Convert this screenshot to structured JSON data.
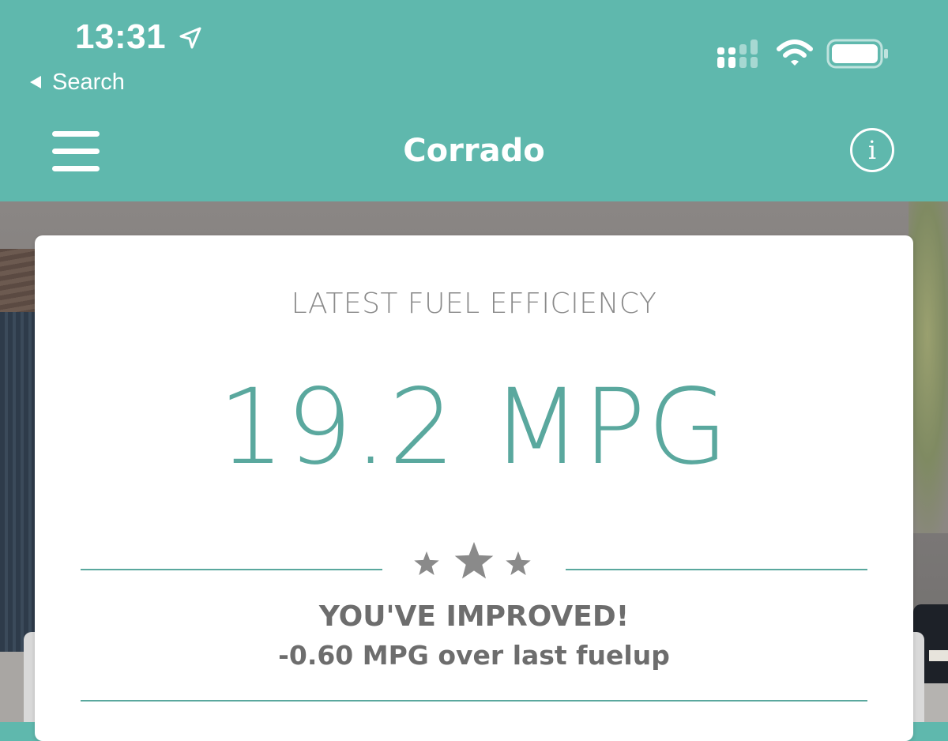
{
  "status_bar": {
    "time": "13:31",
    "back_label": "Search",
    "icons": [
      "location-arrow-icon",
      "cellular-signal-icon",
      "wifi-icon",
      "battery-icon"
    ]
  },
  "nav": {
    "title": "Corrado",
    "menu_icon": "hamburger-menu-icon",
    "info_label": "i"
  },
  "card": {
    "heading": "LATEST FUEL EFFICIENCY",
    "value": "19.2 MPG",
    "rating_icons": [
      "star-icon",
      "star-icon",
      "star-icon"
    ],
    "status_title": "YOU'VE IMPROVED!",
    "status_detail": "-0.60 MPG over last fuelup"
  },
  "colors": {
    "accent": "#5fb8ad",
    "value_text": "#5aa89e",
    "muted_text": "#8a8a8a",
    "star": "#8a8a8a"
  }
}
